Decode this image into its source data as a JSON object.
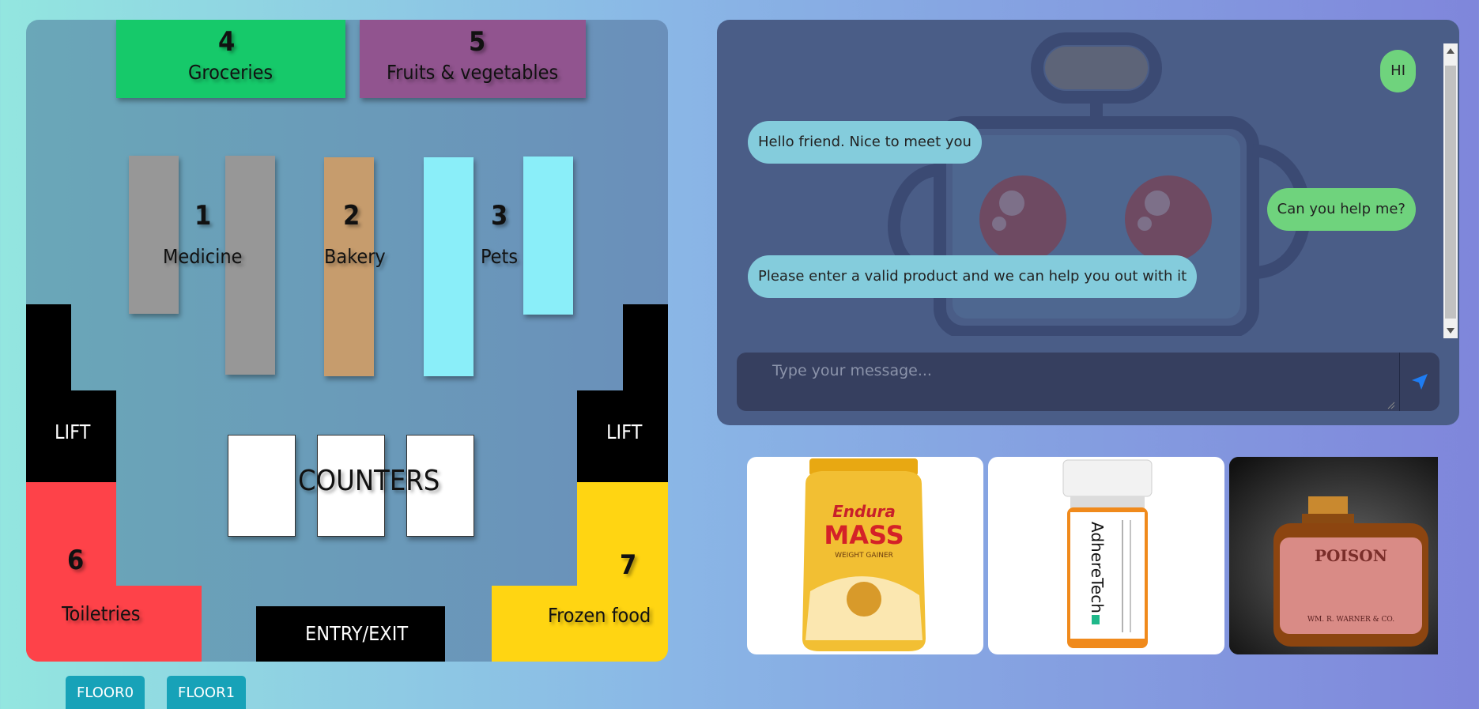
{
  "map": {
    "sections": [
      {
        "number": "4",
        "name": "Groceries",
        "color": "#16c96a"
      },
      {
        "number": "5",
        "name": "Fruits & vegetables",
        "color": "#91548f"
      },
      {
        "number": "1",
        "name": "Medicine",
        "color": "#979797"
      },
      {
        "number": "2",
        "name": "Bakery",
        "color": "#c69c6d"
      },
      {
        "number": "3",
        "name": "Pets",
        "color": "#8aeef9"
      },
      {
        "number": "6",
        "name": "Toiletries",
        "color": "#fe4249"
      },
      {
        "number": "7",
        "name": "Frozen food",
        "color": "#ffd512"
      }
    ],
    "lift_left": "LIFT",
    "lift_right": "LIFT",
    "counters": "COUNTERS",
    "entry_exit": "ENTRY/EXIT"
  },
  "floors": [
    "FLOOR0",
    "FLOOR1"
  ],
  "chat": {
    "messages": [
      {
        "from": "user",
        "text": "HI"
      },
      {
        "from": "bot",
        "text": "Hello friend. Nice to meet you"
      },
      {
        "from": "user",
        "text": "Can you help me?"
      },
      {
        "from": "bot",
        "text": "Please enter a valid product and we can help you out with it"
      }
    ],
    "input_placeholder": "Type your message...",
    "input_value": "",
    "send_icon": "paper-plane-icon",
    "bot_color": "#84ccdc",
    "user_color": "#6fd37d"
  },
  "products": [
    {
      "brand": "Endura",
      "product": "MASS",
      "tagline": "WEIGHT GAINER"
    },
    {
      "brand": "AdhereTech"
    },
    {
      "label": "POISON",
      "maker": "WM. R. WARNER & CO."
    }
  ]
}
